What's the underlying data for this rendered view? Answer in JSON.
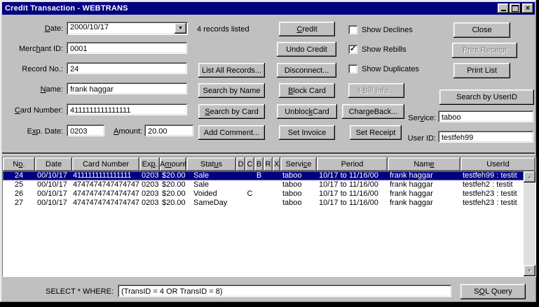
{
  "titlebar": {
    "title": "Credit Transaction - WEBTRANS"
  },
  "icons": {
    "dropdown": "▼",
    "scroll_up": "▲",
    "scroll_down": "▼",
    "check": "✓",
    "close_window": "×"
  },
  "form": {
    "records_listed": "4 records listed",
    "date": {
      "label": {
        "text": "Date:",
        "u": 0
      },
      "value": "2000/10/17"
    },
    "merchant_id": {
      "label": {
        "text": "Merchant ID:",
        "u": 4
      },
      "value": "0001"
    },
    "record_no": {
      "label": {
        "text": "Record No.:",
        "u": -1
      },
      "value": "24"
    },
    "name": {
      "label": {
        "text": "Name:",
        "u": 0
      },
      "value": "frank haggar"
    },
    "card_number": {
      "label": {
        "text": "Card Number:",
        "u": 0
      },
      "value": "4111111111111111"
    },
    "exp_date": {
      "label": {
        "text": "Exp. Date:",
        "u": 1
      },
      "value": "0203"
    },
    "amount": {
      "label": {
        "text": "Amount:",
        "u": 0
      },
      "value": "20.00"
    },
    "service": {
      "label": {
        "text": "Service:",
        "u": 3
      },
      "value": "taboo"
    },
    "user_id": {
      "label": {
        "text": "User ID:",
        "u": -1
      },
      "value": "testfeh99"
    }
  },
  "buttons": {
    "credit": {
      "text": "Credit",
      "u": 0
    },
    "undo_credit": {
      "text": "Undo Credit",
      "u": -1
    },
    "list_all_records": {
      "text": "List All Records...",
      "u": -1
    },
    "disconnect": {
      "text": "Disconnect...",
      "u": -1
    },
    "search_by_name": {
      "text": "Search by Name",
      "u": -1
    },
    "search_by_card": {
      "text": "Search by Card",
      "u": 0
    },
    "add_comment": {
      "text": "Add Comment...",
      "u": -1
    },
    "block_card": {
      "text": "Block Card",
      "u": 0
    },
    "unblock_card": {
      "text": "Unblock Card",
      "u": 6
    },
    "set_invoice": {
      "text": "Set Invoice",
      "u": -1
    },
    "ibill_info": {
      "text": "I-Bill Info...",
      "u": -1,
      "disabled": true
    },
    "chargeback": {
      "text": "ChargeBack...",
      "u": -1
    },
    "set_receipt": {
      "text": "Set Receipt",
      "u": -1
    },
    "close": {
      "text": "Close",
      "u": -1
    },
    "print_receipt": {
      "text": "Print Receipt",
      "u": -1,
      "disabled": true
    },
    "print_list": {
      "text": "Print List",
      "u": -1
    },
    "search_by_userid": {
      "text": "Search by UserID",
      "u": -1
    },
    "sql_query": {
      "text": "SQL Query",
      "u": 1
    }
  },
  "checkboxes": [
    {
      "label": "Show Declines",
      "checked": false
    },
    {
      "label": "Show Rebills",
      "checked": true
    },
    {
      "label": "Show Duplicates",
      "checked": false
    }
  ],
  "table": {
    "columns": [
      {
        "key": "no",
        "text": "No.",
        "u": 1
      },
      {
        "key": "date",
        "text": "Date",
        "u": -1
      },
      {
        "key": "card",
        "text": "Card Number",
        "u": -1
      },
      {
        "key": "exp",
        "text": "Exp.",
        "u": 2
      },
      {
        "key": "amount",
        "text": "Amount",
        "u": 1
      },
      {
        "key": "status",
        "text": "Status",
        "u": 4
      },
      {
        "key": "d",
        "text": "D",
        "u": -1
      },
      {
        "key": "c",
        "text": "C",
        "u": -1
      },
      {
        "key": "b",
        "text": "B",
        "u": -1
      },
      {
        "key": "r",
        "text": "R",
        "u": -1
      },
      {
        "key": "x",
        "text": "X",
        "u": -1
      },
      {
        "key": "service",
        "text": "Service",
        "u": 5
      },
      {
        "key": "period",
        "text": "Period",
        "u": -1
      },
      {
        "key": "name",
        "text": "Name",
        "u": 3
      },
      {
        "key": "userid",
        "text": "UserId",
        "u": -1
      }
    ],
    "rows": [
      {
        "no": "24",
        "date": "00/10/17",
        "card": "4111111111111111",
        "exp": "0203",
        "amount": "$20.00",
        "status": "Sale",
        "d": "",
        "c": "",
        "b": "B",
        "r": "",
        "x": "",
        "service": "taboo",
        "period": "10/17 to 11/16/00",
        "name": "frank haggar",
        "userid": "testfeh99 : testit",
        "selected": true
      },
      {
        "no": "25",
        "date": "00/10/17",
        "card": "4747474747474747",
        "exp": "0203",
        "amount": "$20.00",
        "status": "Sale",
        "d": "",
        "c": "",
        "b": "",
        "r": "",
        "x": "",
        "service": "taboo",
        "period": "10/17 to 11/16/00",
        "name": "frank haggar",
        "userid": "testfeh2 : testit",
        "selected": false
      },
      {
        "no": "26",
        "date": "00/10/17",
        "card": "4747474747474747",
        "exp": "0203",
        "amount": "$20.00",
        "status": "Voided",
        "d": "",
        "c": "C",
        "b": "",
        "r": "",
        "x": "",
        "service": "taboo",
        "period": "10/17 to 11/16/00",
        "name": "frank haggar",
        "userid": "testfeh23 : testit",
        "selected": false
      },
      {
        "no": "27",
        "date": "00/10/17",
        "card": "4747474747474747",
        "exp": "0203",
        "amount": "$20.00",
        "status": "SameDay",
        "d": "",
        "c": "",
        "b": "",
        "r": "",
        "x": "",
        "service": "taboo",
        "period": "10/17 to 11/16/00",
        "name": "frank haggar",
        "userid": "testfeh23 : testit",
        "selected": false
      }
    ]
  },
  "query": {
    "label": {
      "text": "SELECT * WHERE:",
      "u": -1
    },
    "value": "(TransID = 4 OR TransID = 8)"
  },
  "colors": {
    "titlebar": "#000080",
    "face": "#c0c0c0",
    "selection": "#000080"
  }
}
